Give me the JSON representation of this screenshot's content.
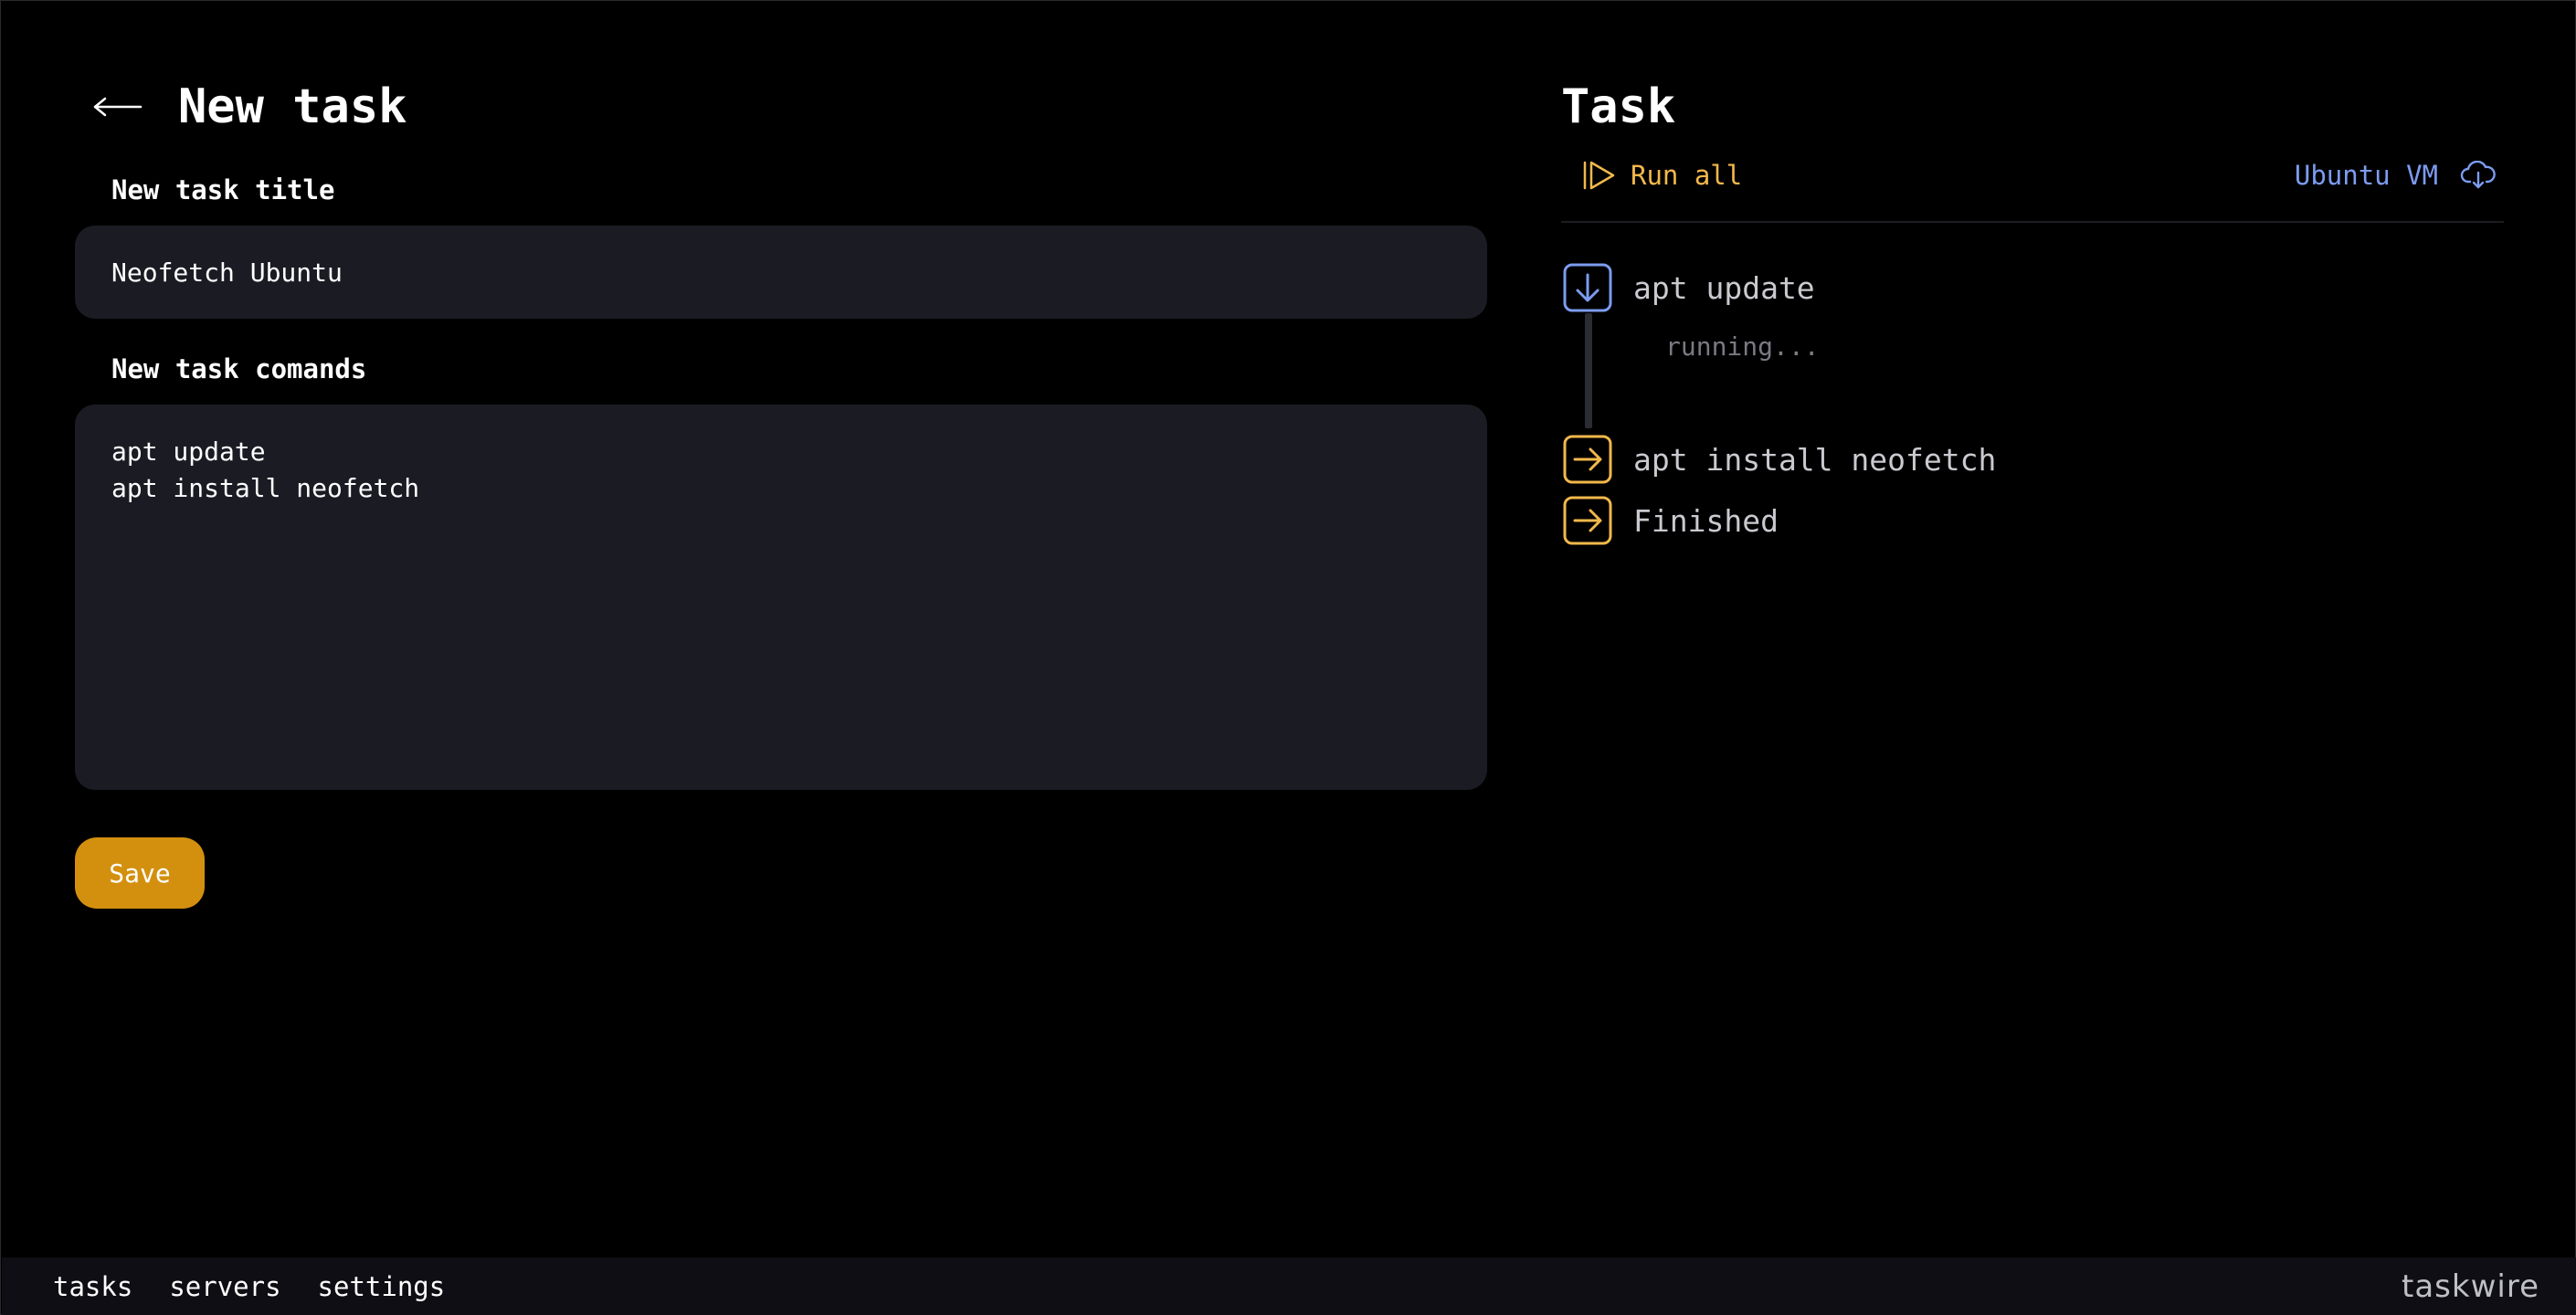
{
  "colors": {
    "background": "#000000",
    "field_background": "#1b1b24",
    "accent_orange": "#d3900f",
    "run_all_yellow": "#f2b84b",
    "server_blue": "#7d9cf0",
    "footer_background": "#0e0e14"
  },
  "editor": {
    "back_icon": "arrow-left-icon",
    "title": "New task",
    "title_field": {
      "label": "New task title",
      "value": "Neofetch Ubuntu"
    },
    "commands_field": {
      "label": "New task comands",
      "value": "apt update\napt install neofetch"
    },
    "save_label": "Save"
  },
  "task": {
    "title": "Task",
    "run_all_label": "Run all",
    "run_all_icon": "play-all-icon",
    "server_label": "Ubuntu VM",
    "server_icon": "cloud-download-icon",
    "steps": [
      {
        "label": "apt update",
        "icon": "arrow-down-square-icon",
        "state": "running",
        "status": "running..."
      },
      {
        "label": "apt install neofetch",
        "icon": "arrow-right-square-icon",
        "state": "pending"
      },
      {
        "label": "Finished",
        "icon": "arrow-right-square-icon",
        "state": "pending"
      }
    ]
  },
  "footer": {
    "nav": [
      "tasks",
      "servers",
      "settings"
    ],
    "brand": "taskwire"
  }
}
